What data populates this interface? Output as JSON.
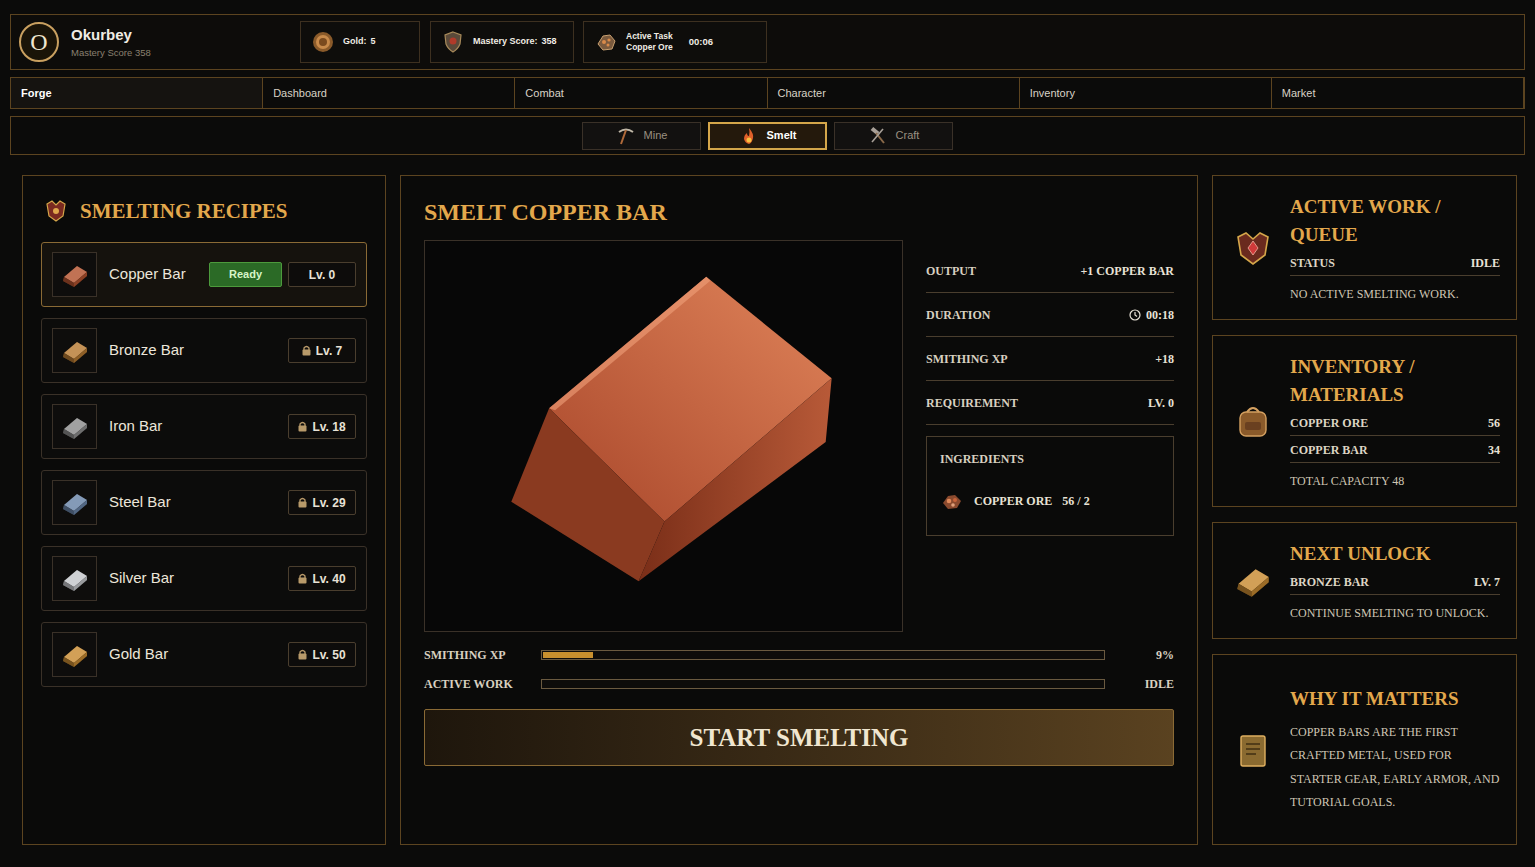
{
  "header": {
    "avatar": "O",
    "player": "Okurbey",
    "subtitle": "Mastery Score 358",
    "stats": [
      {
        "label": "Gold:",
        "value": "5"
      },
      {
        "label": "Mastery Score:",
        "value": "358"
      }
    ],
    "active_task": {
      "label": "Active Task",
      "task": "Copper Ore",
      "time": "00:06"
    }
  },
  "nav": [
    {
      "label": "Forge",
      "selected": true
    },
    {
      "label": "Dashboard",
      "selected": false
    },
    {
      "label": "Combat",
      "selected": false
    },
    {
      "label": "Character",
      "selected": false
    },
    {
      "label": "Inventory",
      "selected": false
    },
    {
      "label": "Market",
      "selected": false
    }
  ],
  "subtabs": [
    {
      "label": "Mine",
      "selected": false
    },
    {
      "label": "Smelt",
      "selected": true
    },
    {
      "label": "Craft",
      "selected": false
    }
  ],
  "recipes": {
    "title": "SMELTING RECIPES",
    "items": [
      {
        "name": "Copper Bar",
        "badge": "Ready",
        "level": "Lv. 0",
        "locked": false,
        "selected": true,
        "color": "#b4532f"
      },
      {
        "name": "Bronze Bar",
        "level": "Lv. 7",
        "locked": true,
        "selected": false,
        "color": "#b77a32"
      },
      {
        "name": "Iron Bar",
        "level": "Lv. 18",
        "locked": true,
        "selected": false,
        "color": "#8d8d8d"
      },
      {
        "name": "Steel Bar",
        "level": "Lv. 29",
        "locked": true,
        "selected": false,
        "color": "#6a84a8"
      },
      {
        "name": "Silver Bar",
        "level": "Lv. 40",
        "locked": true,
        "selected": false,
        "color": "#c5c7cb"
      },
      {
        "name": "Gold Bar",
        "level": "Lv. 50",
        "locked": true,
        "selected": false,
        "color": "#c88b32"
      }
    ]
  },
  "detail": {
    "title": "SMELT COPPER BAR",
    "stats": [
      {
        "label": "OUTPUT",
        "value": "+1 COPPER BAR",
        "kind": "plain"
      },
      {
        "label": "DURATION",
        "value": "00:18",
        "kind": "time"
      },
      {
        "label": "SMITHING XP",
        "value": "+18",
        "kind": "plain"
      },
      {
        "label": "REQUIREMENT",
        "value": "LV. 0",
        "kind": "plain"
      }
    ],
    "ingredients": {
      "title": "INGREDIENTS",
      "items": [
        {
          "name": "COPPER ORE",
          "count": "56 / 2"
        }
      ]
    },
    "progress": [
      {
        "label": "SMITHING XP",
        "level": 0.09,
        "reading": "9%"
      },
      {
        "label": "ACTIVE WORK",
        "level": 0,
        "reading": "IDLE"
      }
    ],
    "button": "START SMELTING"
  },
  "cards": [
    {
      "title": "ACTIVE WORK / QUEUE",
      "rows": [
        {
          "label": "STATUS",
          "value": "IDLE"
        }
      ],
      "note": "NO ACTIVE SMELTING WORK."
    },
    {
      "title": "INVENTORY / MATERIALS",
      "rows": [
        {
          "label": "COPPER ORE",
          "value": "56"
        },
        {
          "label": "COPPER BAR",
          "value": "34"
        }
      ],
      "note": "TOTAL CAPACITY 48"
    },
    {
      "title": "NEXT UNLOCK",
      "rows": [
        {
          "label": "BRONZE BAR",
          "value": "LV. 7"
        }
      ],
      "note": "CONTINUE SMELTING TO UNLOCK."
    },
    {
      "title": "WHY IT MATTERS",
      "rows": [],
      "note": "COPPER BARS ARE THE FIRST CRAFTED METAL, USED FOR STARTER GEAR, EARLY ARMOR, AND TUTORIAL GOALS."
    }
  ]
}
